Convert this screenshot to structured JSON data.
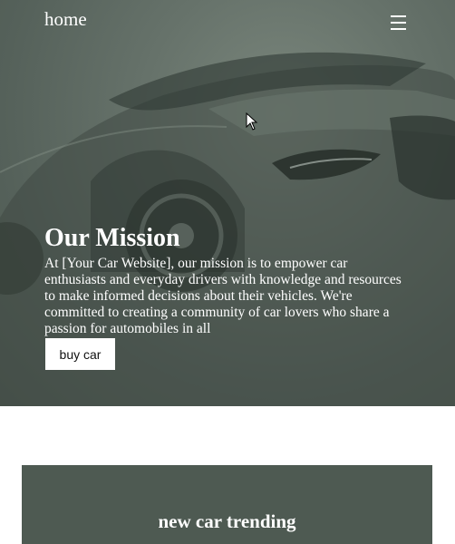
{
  "nav": {
    "home_label": "home",
    "menu_icon": "hamburger-menu-icon"
  },
  "hero": {
    "title": "Our Mission",
    "description": "At [Your Car Website], our mission is to empower car enthusiasts and everyday drivers with knowledge and resources to make informed decisions about their vehicles. We're committed to creating a community of car lovers who share a passion for automobiles in all",
    "button_label": "buy car",
    "background_image": "car-photo",
    "overlay_color": "#5e6a62"
  },
  "trending": {
    "title": "new car trending",
    "background_color": "#4e5a52"
  }
}
